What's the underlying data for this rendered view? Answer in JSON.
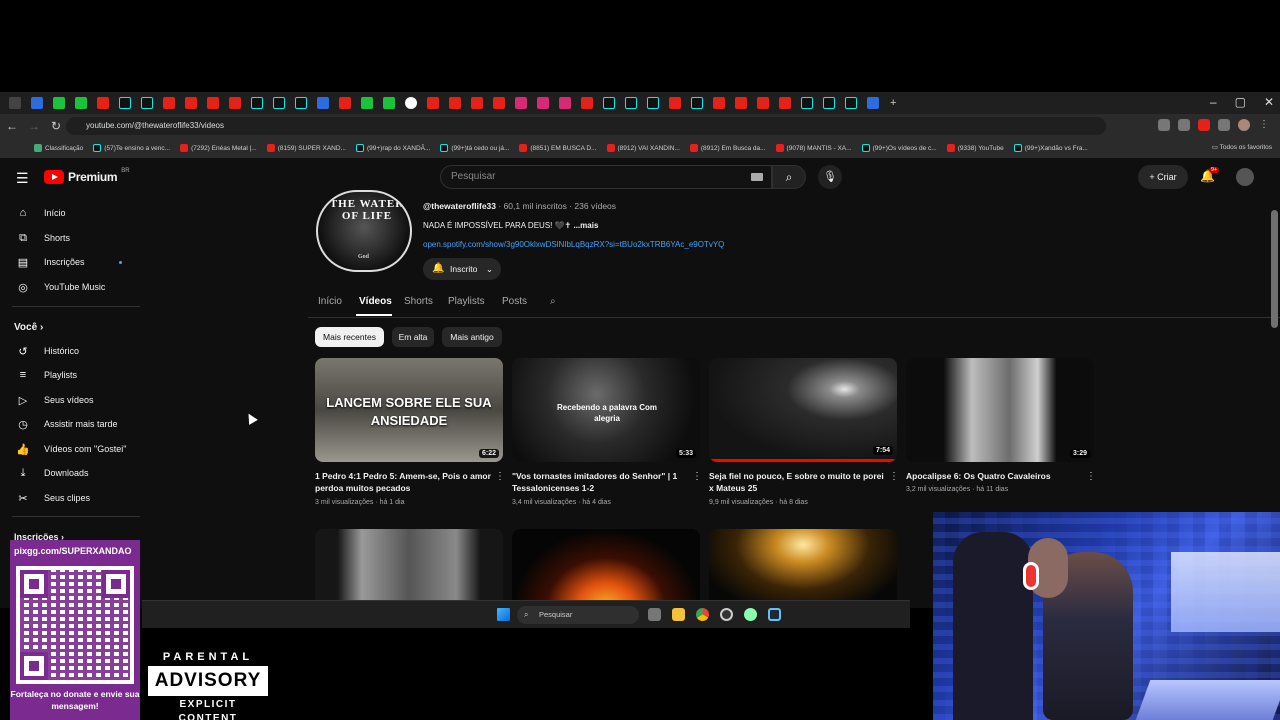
{
  "browser": {
    "url": "youtube.com/@thewateroflife33/videos",
    "bookmarks": [
      "Classificação",
      "(57)Te ensino a venc...",
      "(7292) Enéas Metal |...",
      "(8159) SUPER XAND...",
      "(99+)rap do XANDÃ...",
      "(99+)tá cedo ou já...",
      "(8851) EM BUSCA D...",
      "(8912) VAI XANDIN...",
      "(8912) Em Busca da...",
      "(9078) MANTIS - XA...",
      "(99+)Os vídeos de c...",
      "(9338) YouTube",
      "(99+)Xandão vs Fra..."
    ],
    "all_bookmarks": "Todos os favoritos"
  },
  "youtube": {
    "logo": "Premium",
    "logo_country": "BR",
    "search_placeholder": "Pesquisar",
    "create_label": "Criar",
    "notification_count": "9+",
    "sidebar": {
      "home": "Início",
      "shorts": "Shorts",
      "subscriptions": "Inscrições",
      "music": "YouTube Music",
      "you": "Você",
      "history": "Histórico",
      "playlists": "Playlists",
      "your_videos": "Seus vídeos",
      "watch_later": "Assistir mais tarde",
      "liked": "Vídeos com \"Gostei\"",
      "downloads": "Downloads",
      "clips": "Seus clipes",
      "subs_header": "Inscrições"
    },
    "channel": {
      "handle": "@thewateroflife33",
      "stats": "· 60,1 mil inscritos · 236 vídeos",
      "description": "NADA É IMPOSSÍVEL PARA DEUS! 🖤✝ ",
      "more": "...mais",
      "link": "open.spotify.com/show/3g90OklxwDSlNIbLqBqzRX?si=tBUo2kxTRB6YAc_e9OTvYQ",
      "subscribed_label": "Inscrito",
      "avatar_text": "THE WATER OF LIFE",
      "avatar_god": "God"
    },
    "tabs": [
      "Início",
      "Vídeos",
      "Shorts",
      "Playlists",
      "Posts"
    ],
    "chips": [
      "Mais recentes",
      "Em alta",
      "Mais antigo"
    ],
    "videos": [
      {
        "thumb_text": "LANCEM SOBRE ELE SUA ANSIEDADE",
        "duration": "6:22",
        "title": "1 Pedro 4:1 Pedro 5: Amem-se, Pois o amor perdoa muitos pecados",
        "meta": "3 mil visualizações · há 1 dia",
        "progress": 0
      },
      {
        "thumb_text": "Recebendo a palavra Com alegria",
        "duration": "5:33",
        "title": "\"Vos tornastes imitadores do Senhor\" | 1 Tessalonicenses 1-2",
        "meta": "3,4 mil visualizações · há 4 dias",
        "progress": 0
      },
      {
        "thumb_text": "",
        "duration": "7:54",
        "title": "Seja fiel no pouco, E sobre o muito te porei x Mateus 25",
        "meta": "9,9 mil visualizações · há 8 dias",
        "progress": 1.0
      },
      {
        "thumb_text": "",
        "duration": "3:29",
        "title": "Apocalipse 6: Os Quatro Cavaleiros",
        "meta": "3,2 mil visualizações · há 11 dias",
        "progress": 0
      }
    ]
  },
  "taskbar": {
    "search_label": "Pesquisar"
  },
  "overlay": {
    "pix_url": "pixgg.com/SUPERXANDAO",
    "pix_message": "Fortaleça no donate e envie sua mensagem!",
    "pa_top": "PARENTAL",
    "pa_mid": "ADVISORY",
    "pa_bot": "EXPLICIT CONTENT"
  },
  "colors": {
    "accent": "#ff0000",
    "link": "#3ea6ff",
    "background": "#0f0f0f"
  }
}
